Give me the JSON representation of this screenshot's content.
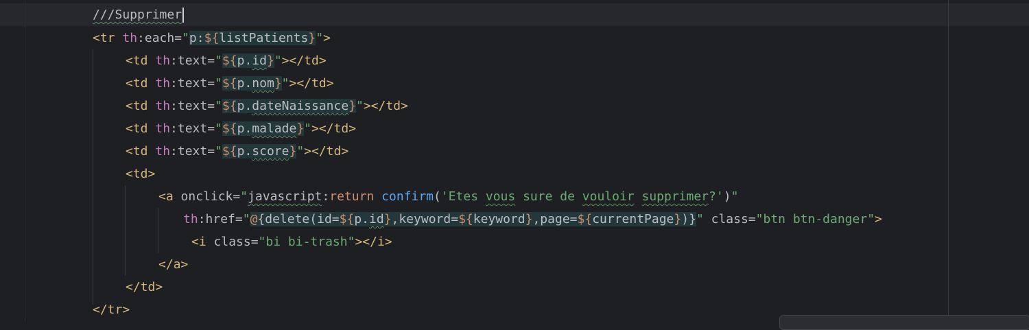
{
  "editor": {
    "lines": [
      {
        "tokens": [
          {
            "t": "///Supprimer",
            "c": "cmt",
            "u": true
          }
        ],
        "caret": true
      },
      {
        "tokens": [
          {
            "t": "<tr ",
            "c": "tag"
          },
          {
            "t": "th",
            "c": "ns"
          },
          {
            "t": ":each=",
            "c": "attr"
          },
          {
            "t": "\"",
            "c": "str"
          },
          {
            "t": "p:",
            "c": "plain",
            "h": true
          },
          {
            "t": "${",
            "c": "brace",
            "h": true
          },
          {
            "t": "listPatients",
            "c": "plain",
            "h": true
          },
          {
            "t": "}",
            "c": "brace",
            "h": true
          },
          {
            "t": "\"",
            "c": "str"
          },
          {
            "t": ">",
            "c": "tag"
          }
        ]
      },
      {
        "tokens": [
          {
            "t": "<td ",
            "c": "tag"
          },
          {
            "t": "th",
            "c": "ns"
          },
          {
            "t": ":text=",
            "c": "attr"
          },
          {
            "t": "\"",
            "c": "str"
          },
          {
            "t": "${",
            "c": "brace",
            "h": true
          },
          {
            "t": "p.",
            "c": "plain",
            "h": true
          },
          {
            "t": "id",
            "c": "plain",
            "h": true,
            "u": true
          },
          {
            "t": "}",
            "c": "brace",
            "h": true
          },
          {
            "t": "\"",
            "c": "str"
          },
          {
            "t": "></td>",
            "c": "tag"
          }
        ]
      },
      {
        "tokens": [
          {
            "t": "<td ",
            "c": "tag"
          },
          {
            "t": "th",
            "c": "ns"
          },
          {
            "t": ":text=",
            "c": "attr"
          },
          {
            "t": "\"",
            "c": "str"
          },
          {
            "t": "${",
            "c": "brace",
            "h": true
          },
          {
            "t": "p.",
            "c": "plain",
            "h": true
          },
          {
            "t": "nom",
            "c": "plain",
            "h": true,
            "u": true
          },
          {
            "t": "}",
            "c": "brace",
            "h": true
          },
          {
            "t": "\"",
            "c": "str"
          },
          {
            "t": "></td>",
            "c": "tag"
          }
        ]
      },
      {
        "tokens": [
          {
            "t": "<td ",
            "c": "tag"
          },
          {
            "t": "th",
            "c": "ns"
          },
          {
            "t": ":text=",
            "c": "attr"
          },
          {
            "t": "\"",
            "c": "str"
          },
          {
            "t": "${",
            "c": "brace",
            "h": true
          },
          {
            "t": "p.",
            "c": "plain",
            "h": true
          },
          {
            "t": "dateNaissance",
            "c": "plain",
            "h": true,
            "u": true
          },
          {
            "t": "}",
            "c": "brace",
            "h": true
          },
          {
            "t": "\"",
            "c": "str"
          },
          {
            "t": "></td>",
            "c": "tag"
          }
        ]
      },
      {
        "tokens": [
          {
            "t": "<td ",
            "c": "tag"
          },
          {
            "t": "th",
            "c": "ns"
          },
          {
            "t": ":text=",
            "c": "attr"
          },
          {
            "t": "\"",
            "c": "str"
          },
          {
            "t": "${",
            "c": "brace",
            "h": true
          },
          {
            "t": "p.",
            "c": "plain",
            "h": true
          },
          {
            "t": "malade",
            "c": "plain",
            "h": true,
            "u": true
          },
          {
            "t": "}",
            "c": "brace",
            "h": true
          },
          {
            "t": "\"",
            "c": "str"
          },
          {
            "t": "></td>",
            "c": "tag"
          }
        ]
      },
      {
        "tokens": [
          {
            "t": "<td ",
            "c": "tag"
          },
          {
            "t": "th",
            "c": "ns"
          },
          {
            "t": ":text=",
            "c": "attr"
          },
          {
            "t": "\"",
            "c": "str"
          },
          {
            "t": "${",
            "c": "brace",
            "h": true
          },
          {
            "t": "p.",
            "c": "plain",
            "h": true
          },
          {
            "t": "score",
            "c": "plain",
            "h": true,
            "u": true
          },
          {
            "t": "}",
            "c": "brace",
            "h": true
          },
          {
            "t": "\"",
            "c": "str"
          },
          {
            "t": "></td>",
            "c": "tag"
          }
        ]
      },
      {
        "tokens": [
          {
            "t": "<td>",
            "c": "tag"
          }
        ]
      },
      {
        "tokens": [
          {
            "t": "<a ",
            "c": "tag"
          },
          {
            "t": "onclick=",
            "c": "attr"
          },
          {
            "t": "\"",
            "c": "str"
          },
          {
            "t": "javascript",
            "c": "plain",
            "u": true
          },
          {
            "t": ":",
            "c": "plain"
          },
          {
            "t": "return ",
            "c": "kw"
          },
          {
            "t": "confirm",
            "c": "fn"
          },
          {
            "t": "(",
            "c": "plain"
          },
          {
            "t": "'Etes ",
            "c": "str"
          },
          {
            "t": "vous",
            "c": "str",
            "u": true
          },
          {
            "t": " sure de ",
            "c": "str"
          },
          {
            "t": "vouloir",
            "c": "str",
            "u": true
          },
          {
            "t": " ",
            "c": "str"
          },
          {
            "t": "supprimer",
            "c": "str",
            "u": true
          },
          {
            "t": "?'",
            "c": "str"
          },
          {
            "t": ")",
            "c": "plain"
          },
          {
            "t": "\"",
            "c": "str"
          }
        ]
      },
      {
        "tokens": [
          {
            "t": "th",
            "c": "ns"
          },
          {
            "t": ":href=",
            "c": "attr"
          },
          {
            "t": "\"",
            "c": "str"
          },
          {
            "t": "@",
            "c": "brace",
            "h": true
          },
          {
            "t": "{",
            "c": "plain",
            "h": true
          },
          {
            "t": "delete(id=",
            "c": "plain",
            "h": true
          },
          {
            "t": "${",
            "c": "brace",
            "h": true
          },
          {
            "t": "p.",
            "c": "plain",
            "h": true
          },
          {
            "t": "id",
            "c": "plain",
            "h": true,
            "u": true
          },
          {
            "t": "}",
            "c": "brace",
            "h": true
          },
          {
            "t": ",keyword=",
            "c": "plain",
            "h": true
          },
          {
            "t": "${",
            "c": "brace",
            "h": true
          },
          {
            "t": "keyword",
            "c": "plain",
            "h": true
          },
          {
            "t": "}",
            "c": "brace",
            "h": true
          },
          {
            "t": ",page=",
            "c": "plain",
            "h": true
          },
          {
            "t": "${",
            "c": "brace",
            "h": true
          },
          {
            "t": "currentPage",
            "c": "plain",
            "h": true
          },
          {
            "t": "}",
            "c": "brace",
            "h": true
          },
          {
            "t": ")}",
            "c": "plain",
            "h": true
          },
          {
            "t": "\"",
            "c": "str"
          },
          {
            "t": " class=",
            "c": "attr"
          },
          {
            "t": "\"btn btn-danger\"",
            "c": "str"
          },
          {
            "t": ">",
            "c": "tag"
          }
        ]
      },
      {
        "tokens": [
          {
            "t": "<i ",
            "c": "tag"
          },
          {
            "t": "class=",
            "c": "attr"
          },
          {
            "t": "\"bi bi-trash\"",
            "c": "str"
          },
          {
            "t": "></i>",
            "c": "tag"
          }
        ]
      },
      {
        "tokens": [
          {
            "t": "</a>",
            "c": "tag"
          }
        ]
      },
      {
        "tokens": [
          {
            "t": "</td>",
            "c": "tag"
          }
        ]
      },
      {
        "tokens": [
          {
            "t": "</tr>",
            "c": "tag"
          }
        ]
      }
    ]
  }
}
